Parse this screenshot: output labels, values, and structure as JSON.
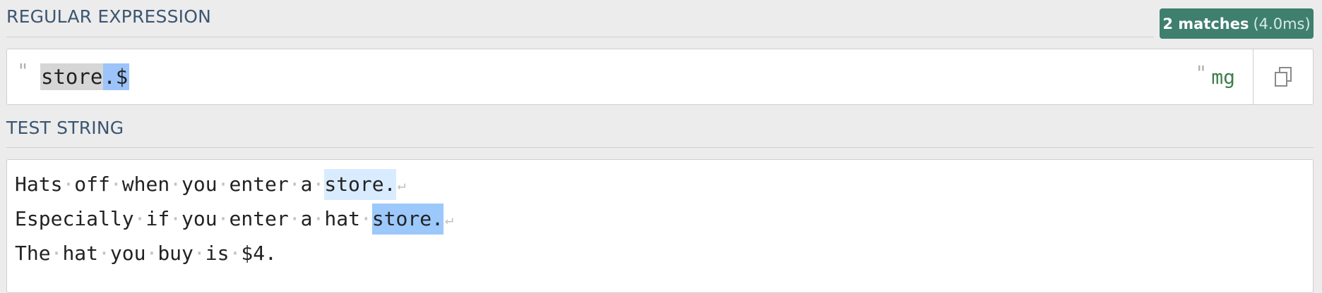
{
  "regex_section": {
    "title": "REGULAR EXPRESSION",
    "open_delim": "\"",
    "close_delim": "\"",
    "pattern_literal": "store",
    "pattern_meta": ".$",
    "flags": "mg"
  },
  "match_info": {
    "count_label": "2 matches",
    "time_label": "(4.0ms)"
  },
  "test_section": {
    "title": "TEST STRING",
    "lines": [
      {
        "before": "Hats·off·when·you·enter·a·",
        "match": "store.",
        "after": "",
        "return": "↵"
      },
      {
        "before": "Especially·if·you·enter·a·hat·",
        "match": "store.",
        "after": "",
        "return": "↵"
      },
      {
        "before": "The·hat·you·buy·is·$4.",
        "match": "",
        "after": "",
        "return": ""
      }
    ]
  },
  "icons": {
    "copy": "copy-icon"
  },
  "colors": {
    "badge_bg": "#3f7f6d",
    "title_text": "#3b5671",
    "flags_text": "#3e7d4e",
    "match_primary": "#d9ecff",
    "match_secondary": "#9cc8fb",
    "token_literal": "#d6d6d6",
    "token_meta": "#9cc4fb"
  }
}
